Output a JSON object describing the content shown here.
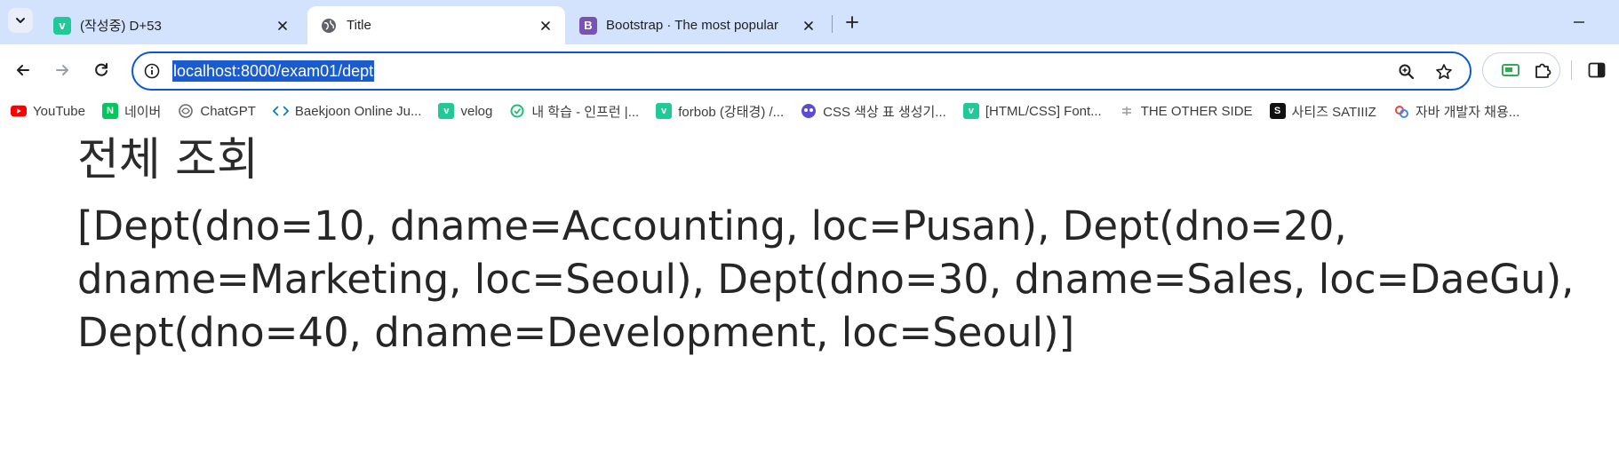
{
  "tabs": [
    {
      "title": "(작성중) D+53",
      "favicon": "velog-icon",
      "favicon_color": "#20c997",
      "favicon_letter": "v"
    },
    {
      "title": "Title",
      "favicon": "globe-icon",
      "favicon_color": "#5f6368",
      "favicon_letter": ""
    },
    {
      "title": "Bootstrap · The most popular",
      "favicon": "bootstrap-icon",
      "favicon_color": "#7952b3",
      "favicon_letter": "B"
    }
  ],
  "address_bar": {
    "url": "localhost:8000/exam01/dept"
  },
  "bookmarks": [
    {
      "label": "YouTube",
      "icon": "youtube-icon",
      "color": "#ff0000"
    },
    {
      "label": "네이버",
      "icon": "naver-icon",
      "color": "#03c75a",
      "letter": "N"
    },
    {
      "label": "ChatGPT",
      "icon": "chatgpt-icon",
      "color": "#6b6b6b"
    },
    {
      "label": "Baekjoon Online Ju...",
      "icon": "code-icon",
      "color": "#0076c0"
    },
    {
      "label": "velog",
      "icon": "velog-icon",
      "color": "#20c997",
      "letter": "v"
    },
    {
      "label": "내 학습 - 인프런 |...",
      "icon": "inflearn-icon",
      "color": "#1dc078"
    },
    {
      "label": "forbob (강태경) /...",
      "icon": "velog-icon",
      "color": "#20c997",
      "letter": "v"
    },
    {
      "label": "CSS 색상 표 생성기...",
      "icon": "mask-icon",
      "color": "#5b4bd6"
    },
    {
      "label": "[HTML/CSS] Font...",
      "icon": "velog-icon",
      "color": "#20c997",
      "letter": "v"
    },
    {
      "label": "THE OTHER SIDE",
      "icon": "dots-icon",
      "color": "#9a9a9a"
    },
    {
      "label": "사티즈 SATIIIZ",
      "icon": "satiiz-icon",
      "color": "#111111",
      "letter": "S"
    },
    {
      "label": "자바 개발자 채용...",
      "icon": "jobs-icon",
      "color": "#e8453c"
    }
  ],
  "page": {
    "title": "전체 조회",
    "content": "[Dept(dno=10, dname=Accounting, loc=Pusan), Dept(dno=20, dname=Marketing, loc=Seoul), Dept(dno=30, dname=Sales, loc=DaeGu), Dept(dno=40, dname=Development, loc=Seoul)]"
  },
  "colors": {
    "tabstrip": "#d3e3fd",
    "omnibox_border": "#0b57d0",
    "selection": "#1a5bcf"
  }
}
